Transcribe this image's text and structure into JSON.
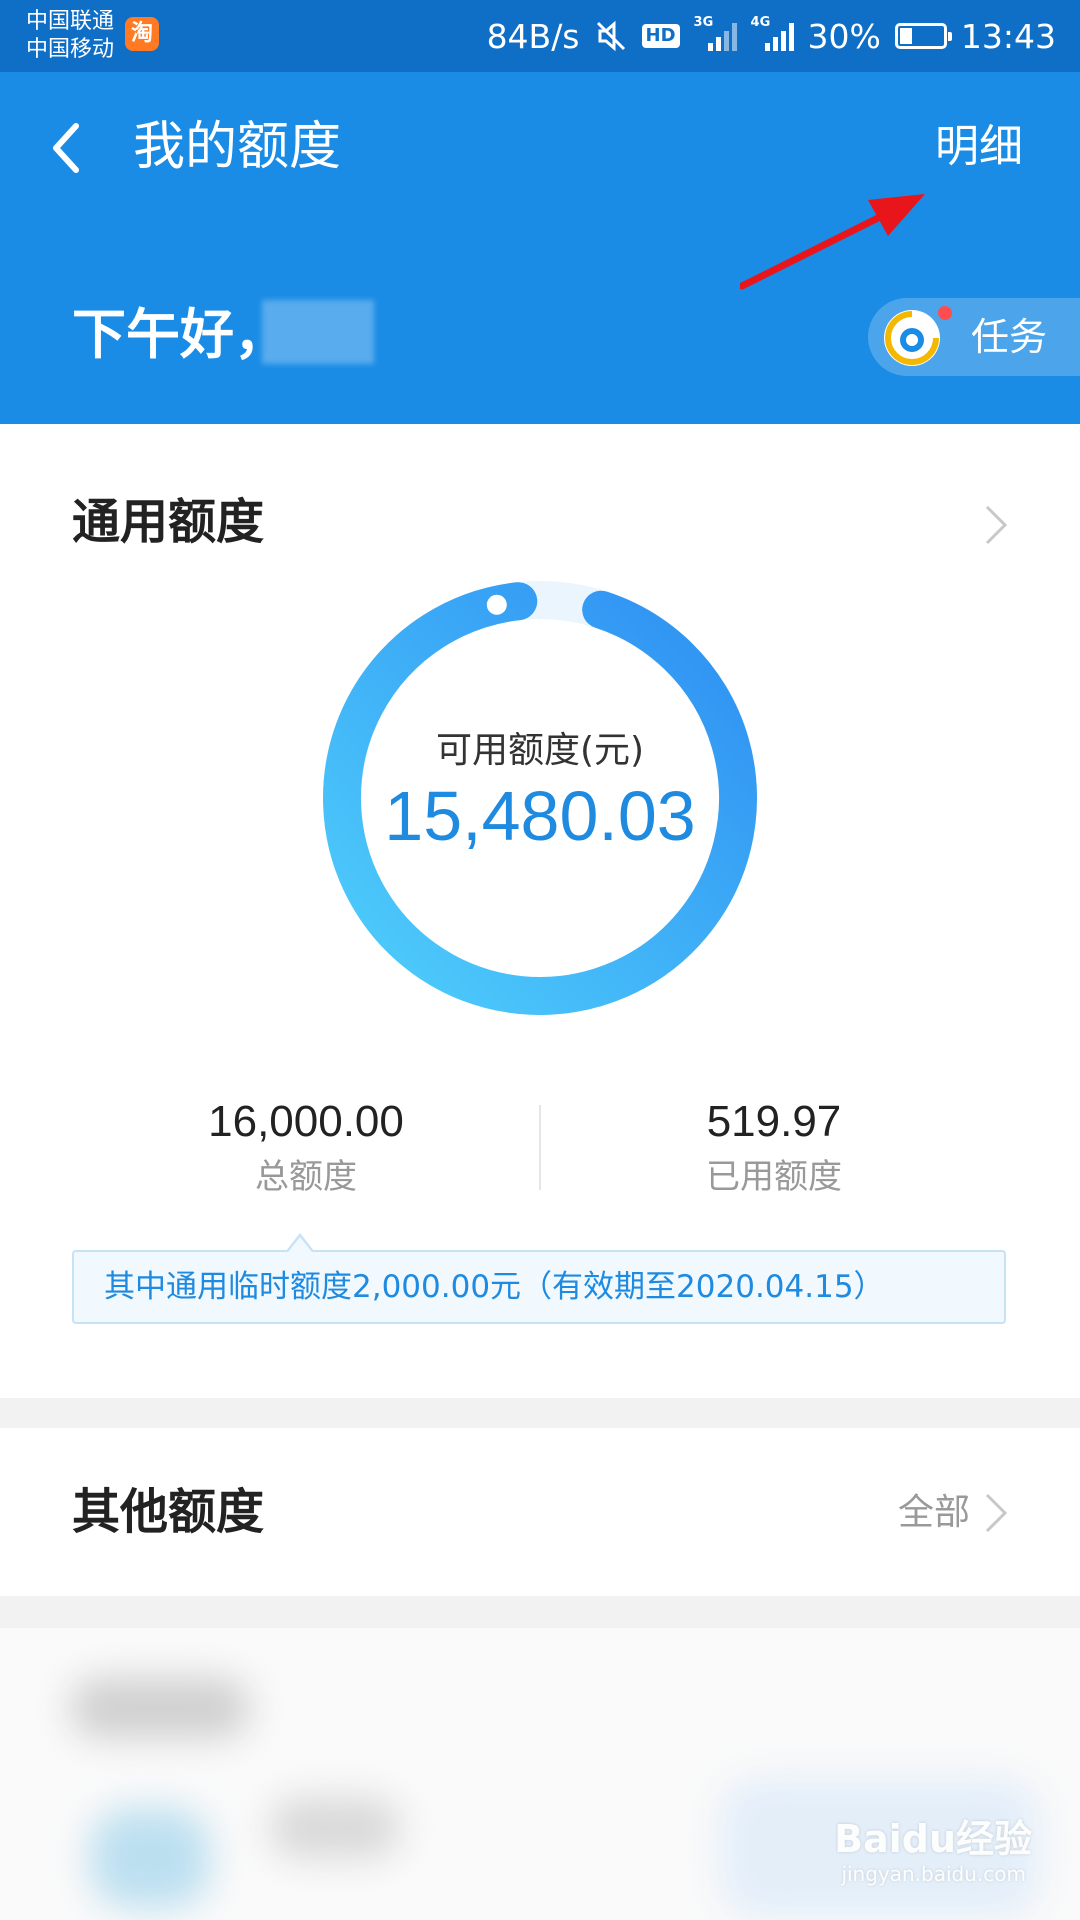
{
  "status_bar": {
    "carrier_1": "中国联通",
    "carrier_2": "中国移动",
    "carrier_badge": "淘",
    "net_speed": "84B/s",
    "hd": "HD",
    "signal_1_tag": "3G",
    "signal_2_tag": "4G",
    "battery": "30%",
    "battery_level": 0.3,
    "time": "13:43"
  },
  "header": {
    "title": "我的额度",
    "detail_label": "明细",
    "greeting": "下午好，",
    "task_label": "任务",
    "bg_color": "#1a8ce6"
  },
  "general": {
    "title": "通用额度",
    "available_caption": "可用额度(元)",
    "available_value": "15,480.03",
    "used_fraction": 0.0325,
    "total_value": "16,000.00",
    "total_label": "总额度",
    "used_value": "519.97",
    "used_label": "已用额度",
    "notice": "其中通用临时额度2,000.00元（有效期至2020.04.15）",
    "accent_color": "#1e8ae0"
  },
  "other": {
    "title": "其他额度",
    "all_label": "全部"
  },
  "watermark": {
    "brand": "Baidu经验",
    "url": "jingyan.baidu.com"
  },
  "icons": [
    "back-arrow-icon",
    "mute-icon",
    "signal-icon",
    "battery-icon",
    "task-mascot-icon",
    "chevron-right-icon",
    "red-annotation-arrow"
  ]
}
